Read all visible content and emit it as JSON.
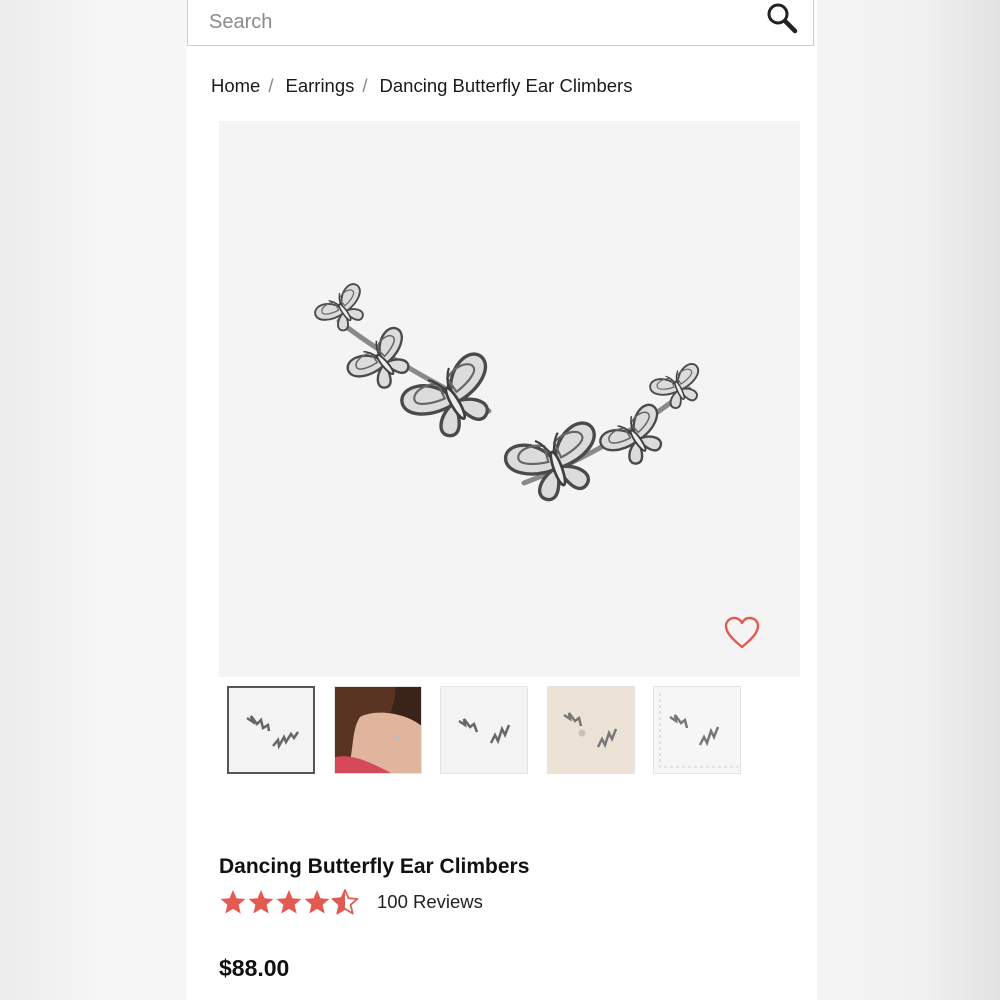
{
  "search": {
    "placeholder": "Search"
  },
  "breadcrumb": {
    "items": [
      "Home",
      "Earrings",
      "Dancing Butterfly Ear Climbers"
    ]
  },
  "product": {
    "title": "Dancing Butterfly Ear Climbers",
    "rating": 4.5,
    "rating_max": 5,
    "reviews_label": "100 Reviews",
    "price": "$88.00"
  },
  "gallery": {
    "thumbnail_count": 5,
    "selected_index": 0
  },
  "icons": {
    "search": "search-icon",
    "wishlist": "heart-icon",
    "star": "star-icon"
  },
  "colors": {
    "accent": "#e35a52",
    "text": "#111111",
    "hero_bg": "#f4f4f4"
  }
}
